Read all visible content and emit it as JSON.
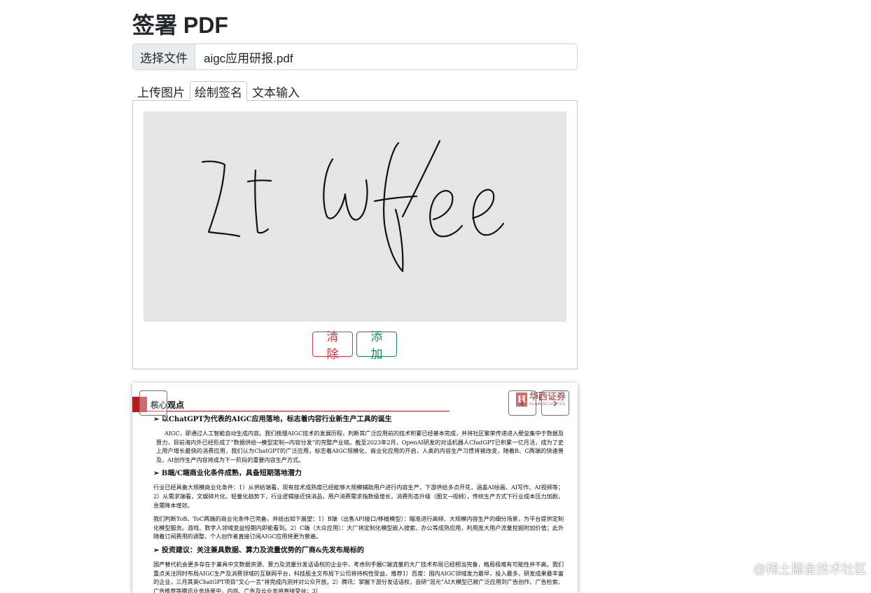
{
  "page": {
    "title": "签署 PDF"
  },
  "file_input": {
    "button_label": "选择文件",
    "file_name": "aigc应用研报.pdf"
  },
  "tabs": [
    {
      "label": "上传图片",
      "active": false
    },
    {
      "label": "绘制签名",
      "active": true
    },
    {
      "label": "文本输入",
      "active": false
    }
  ],
  "signature": {
    "canvas_color": "#e5e5e5",
    "clear_label": "清除",
    "add_label": "添加"
  },
  "pdf_preview": {
    "prev_icon": "chevron-left-icon",
    "next_icon": "chevron-right-icon",
    "logo_mark": "H",
    "logo_cn": "华西证券",
    "logo_en": "HUAXI SECURITIES",
    "section_title": "核心观点",
    "sections": [
      {
        "heading": "➢  以ChatGPT为代表的AIGC应用落地，标志着内容行业新生产工具的诞生",
        "paragraphs": [
          "AIGC，即通过人工智能自动生成内容。我们梳理AIGC技术的发展历程，判断其广泛应用前的技术积累已经基本完成，并将社区繁荣传递进入壁垒集中于数据及算力，目前海内外已经形成了“数据供给→模型定制→内容分发”的完整产业链。截至2023年2月，OpenAI研发的对话机器人ChatGPT已积累一亿月活，成为了史上用户增长最快的消费应用，我们认为ChatGPT的广泛应用，标志着AIGC规模化、商业化应用的开启，人类的内容生产习惯将被改变，随着B、C两端的快速普及，AI创作生产内容将成为下一阶段的重要内容生产方式。"
        ]
      },
      {
        "heading": "➢  B端/C端商业化条件成熟，具备短期落地潜力",
        "paragraphs": [
          "行业已经具备大规模商业化条件：1）从供给端看，现有技术成熟度已经能够大规模辅助用户进行内容生产，下游供给多点开花，涵盖AI绘画、AI写作、AI视频等；2）从需求端看，文娱碎片化、轻量化趋势下，行业逻辑接近快消品，用户消费需求指数级增长，消费形态升级（图文→视频），传统生产方式下行业成本压力加剧，急需降本增效。",
          "我们判断ToB、ToC两端的商业化条件已完备，并给出如下展望：1）B端（出售API接口/移植模型）：瞄准进行高频、大规模内容生产的细分场景，为平台提供定制化模型服务。游戏、数字人领域变益短期内即能看到。2）C端（大众应用）：大厂将定制化模型嵌入搜索、办公等成熟应用，利用庞大用户流量挖掘附加价值；此外随着订阅费用的调整，个人创作者直接订阅AIGC应用将更为普遍。"
        ]
      },
      {
        "heading": "➢  投资建议：关注兼具数据、算力及流量优势的厂商&先发布局标的",
        "paragraphs": [
          "国产替代机会更多存在于兼具中文数据资源、算力及流量分发话语权的企业中，考虑到手握C端流量的大厂技术布局已经相当完备，格局极难有可能性并不高。我们重点关注同时布局AIGC生产及消费领域的互联网平台，科技股主文布局下公司将持构性受益，推荐1）百度：国内AIGC领域发力最早，投入最多，研发成果最丰富的企业，三月其英ChatGPT项目“文心一言”将完成内测并对公众开放。2）腾讯：掌握下游分发话语权，自研“混元”AI大模型已被广泛应用到广告创作、广告检索、广告推荐等腾讯业务场景中，内容、广告及云业务将直接受益；3）"
        ]
      }
    ]
  },
  "watermark": "@稀土掘金技术社区"
}
